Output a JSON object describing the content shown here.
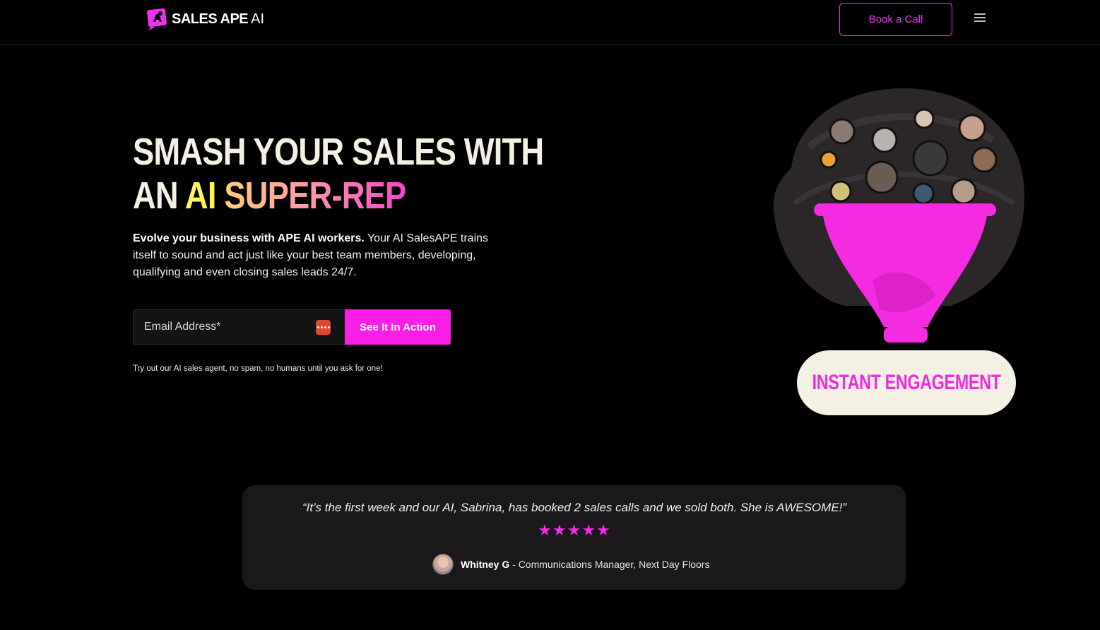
{
  "header": {
    "logo_text": "SALES APE",
    "logo_suffix": "AI",
    "book_button": "Book a Call",
    "menu_icon": "hamburger-menu-icon"
  },
  "hero": {
    "title_line1": "SMASH YOUR SALES WITH",
    "title_line2_prefix": "AN ",
    "title_line2_highlight_ai": "AI",
    "title_line2_highlight_rep": "SUPER-REP",
    "description_bold": "Evolve your business with APE AI workers.",
    "description_rest": " Your AI SalesAPE trains itself to sound and act just like your best team members, developing, qualifying and even closing sales leads 24/7.",
    "email_placeholder": "Email Address*",
    "cta_button": "See It In Action",
    "fine_print": "Try out our AI sales agent, no spam, no humans until you ask for one!"
  },
  "illustration": {
    "badge_text": "INSTANT ENGAGEMENT",
    "icon": "sales-funnel-icon"
  },
  "testimonial": {
    "quote": "“It’s the first week and our AI, Sabrina, has booked 2 sales calls and we sold both. She is AWESOME!”",
    "stars": "★★★★★",
    "rating": 5,
    "author_name": "Whitney G",
    "author_separator": " - ",
    "author_role": "Communications Manager, Next Day Floors"
  },
  "colors": {
    "accent": "#fa1ee6",
    "cream": "#f5f0e4",
    "yellow": "#fff35c",
    "background": "#000000",
    "card": "#1a181b"
  }
}
